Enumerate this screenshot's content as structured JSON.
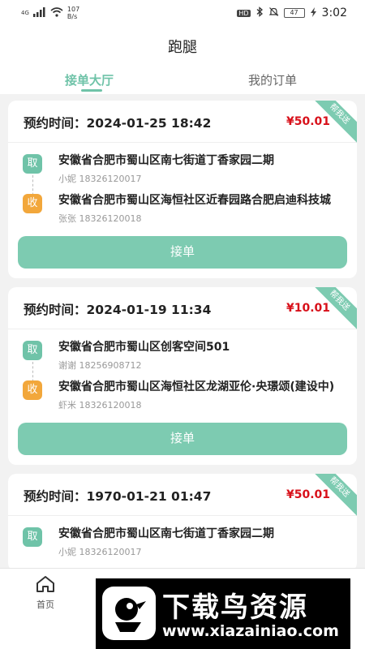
{
  "status_bar": {
    "network": "4G",
    "speed": "107\nB/s",
    "hd": "HD",
    "battery": "47",
    "time": "3:02"
  },
  "header": {
    "title": "跑腿",
    "tabs": [
      {
        "label": "接单大厅",
        "active": true
      },
      {
        "label": "我的订单",
        "active": false
      }
    ]
  },
  "orders": [
    {
      "time_label": "预约时间：2024-01-25 18:42",
      "price": "¥50.01",
      "ribbon": "帮我送",
      "pickup_badge": "取",
      "pickup_address": "安徽省合肥市蜀山区南七街道丁香家园二期",
      "pickup_contact": "小妮 18326120017",
      "dropoff_badge": "收",
      "dropoff_address": "安徽省合肥市蜀山区海恒社区近春园路合肥启迪科技城",
      "dropoff_contact": "张张 18326120018",
      "button": "接单"
    },
    {
      "time_label": "预约时间：2024-01-19 11:34",
      "price": "¥10.01",
      "ribbon": "帮我送",
      "pickup_badge": "取",
      "pickup_address": "安徽省合肥市蜀山区创客空间501",
      "pickup_contact": "谢谢 18256908712",
      "dropoff_badge": "收",
      "dropoff_address": "安徽省合肥市蜀山区海恒社区龙湖亚伦·央璟颂(建设中)",
      "dropoff_contact": "虾米 18326120018",
      "button": "接单"
    },
    {
      "time_label": "预约时间：1970-01-21 01:47",
      "price": "¥50.01",
      "ribbon": "帮我送",
      "pickup_badge": "取",
      "pickup_address": "安徽省合肥市蜀山区南七街道丁香家园二期",
      "pickup_contact": "小妮 18326120017"
    }
  ],
  "bottom_nav": {
    "home_label": "首页",
    "home_icon": "home-icon"
  },
  "watermark": {
    "title": "下载鸟资源",
    "url": "www.xiazainiao.com"
  },
  "colors": {
    "accent": "#7dcbb1",
    "price": "#d8101a",
    "receive_badge": "#f2a73b"
  }
}
